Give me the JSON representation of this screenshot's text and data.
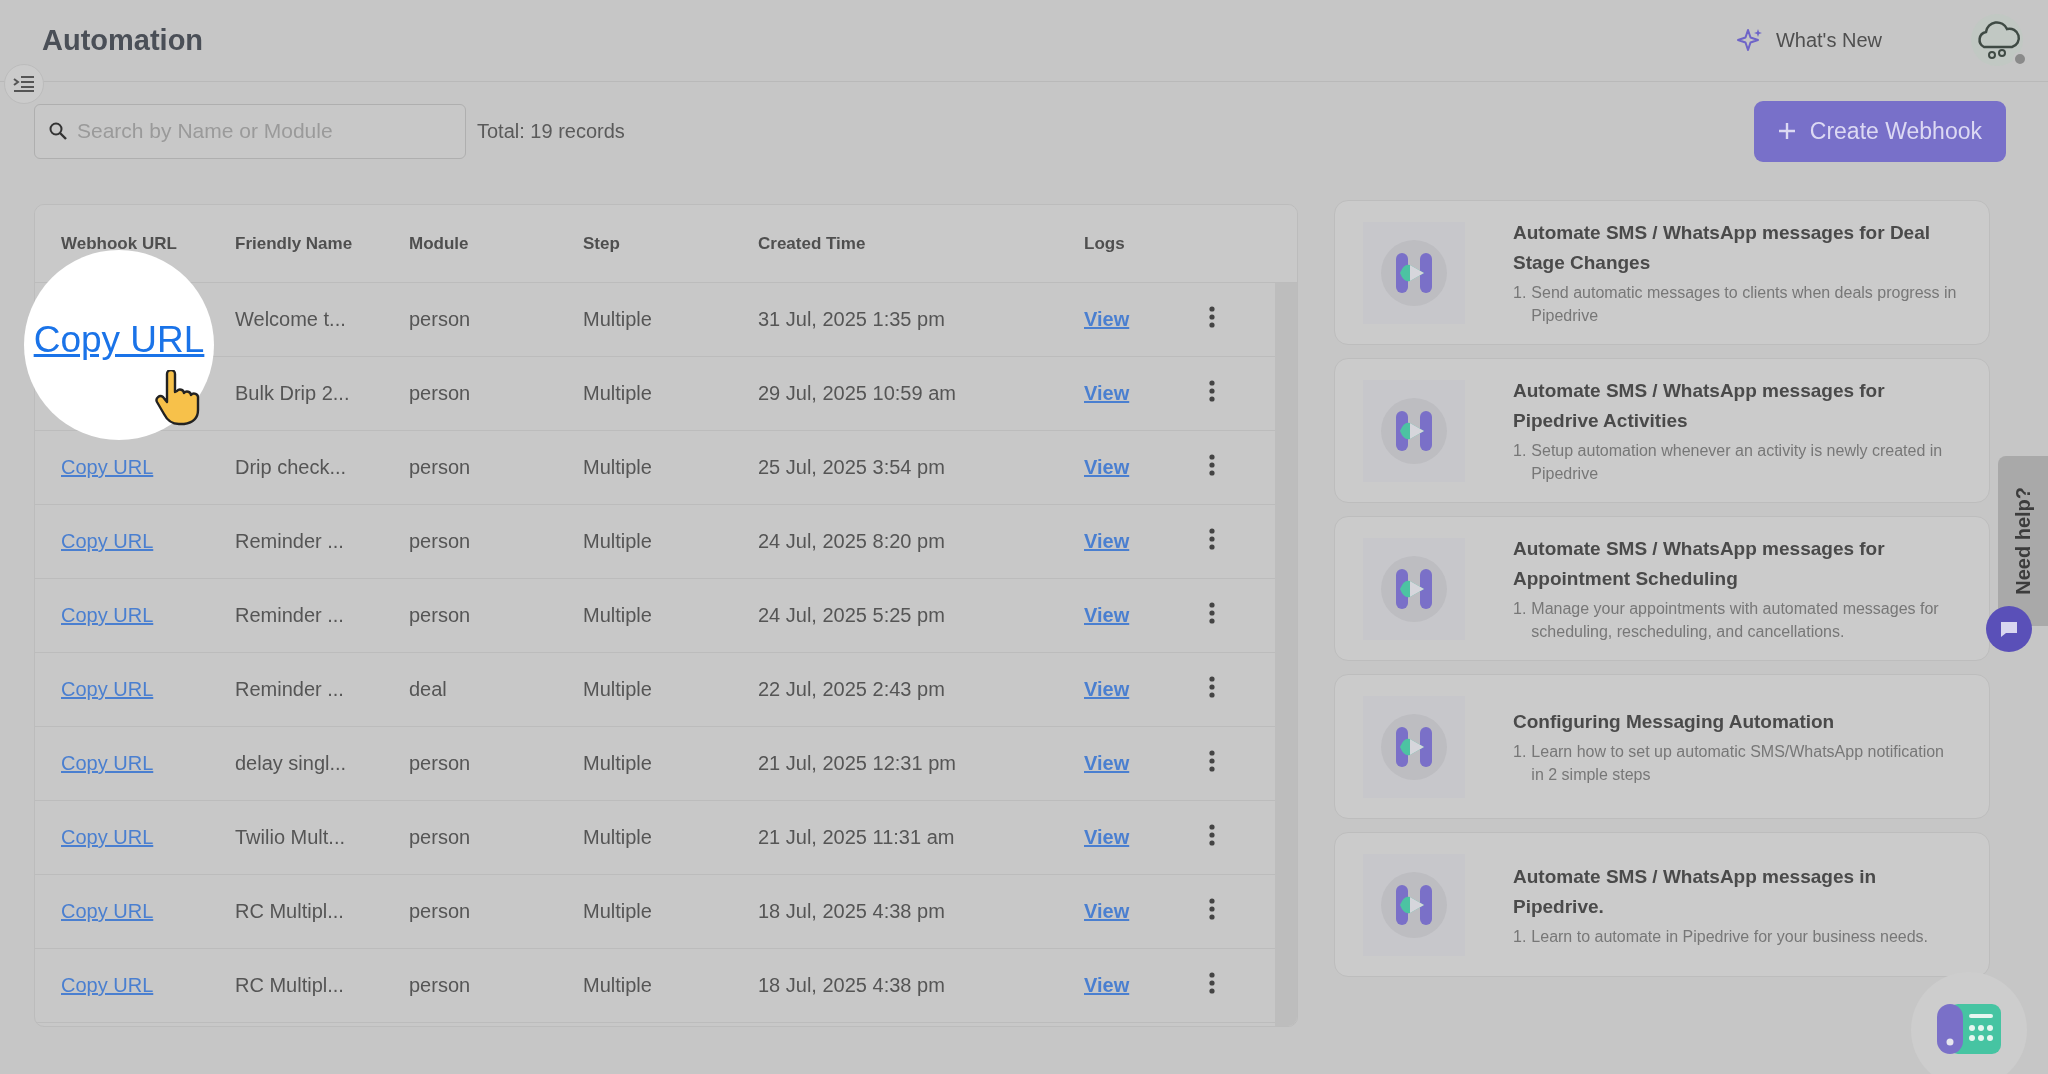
{
  "page": {
    "title": "Automation",
    "whats_new": "What's New"
  },
  "search": {
    "placeholder": "Search by Name or Module"
  },
  "total": "Total: 19 records",
  "create_button": "Create Webhook",
  "table": {
    "columns": [
      "Webhook URL",
      "Friendly Name",
      "Module",
      "Step",
      "Created Time",
      "Logs"
    ],
    "rows": [
      {
        "name": "Welcome t...",
        "module": "person",
        "step": "Multiple",
        "created": "31 Jul, 2025 1:35 pm",
        "logs": "View"
      },
      {
        "name": "Bulk Drip 2...",
        "module": "person",
        "step": "Multiple",
        "created": "29 Jul, 2025 10:59 am",
        "logs": "View"
      },
      {
        "url": "Copy URL",
        "name": "Drip check...",
        "module": "person",
        "step": "Multiple",
        "created": "25 Jul, 2025 3:54 pm",
        "logs": "View"
      },
      {
        "url": "Copy URL",
        "name": "Reminder ...",
        "module": "person",
        "step": "Multiple",
        "created": "24 Jul, 2025 8:20 pm",
        "logs": "View"
      },
      {
        "url": "Copy URL",
        "name": "Reminder ...",
        "module": "person",
        "step": "Multiple",
        "created": "24 Jul, 2025 5:25 pm",
        "logs": "View"
      },
      {
        "url": "Copy URL",
        "name": "Reminder ...",
        "module": "deal",
        "step": "Multiple",
        "created": "22 Jul, 2025 2:43 pm",
        "logs": "View"
      },
      {
        "url": "Copy URL",
        "name": "delay singl...",
        "module": "person",
        "step": "Multiple",
        "created": "21 Jul, 2025 12:31 pm",
        "logs": "View"
      },
      {
        "url": "Copy URL",
        "name": "Twilio Mult...",
        "module": "person",
        "step": "Multiple",
        "created": "21 Jul, 2025 11:31 am",
        "logs": "View"
      },
      {
        "url": "Copy URL",
        "name": "RC Multipl...",
        "module": "person",
        "step": "Multiple",
        "created": "18 Jul, 2025 4:38 pm",
        "logs": "View"
      },
      {
        "url": "Copy URL",
        "name": "RC Multipl...",
        "module": "person",
        "step": "Multiple",
        "created": "18 Jul, 2025 4:38 pm",
        "logs": "View"
      }
    ]
  },
  "spotlight": {
    "text": "Copy URL"
  },
  "guides": [
    {
      "title": "Automate SMS / WhatsApp messages for Deal Stage Changes",
      "steps": [
        {
          "marker": "1.",
          "text": "Send automatic messages to clients when deals progress in Pipedrive"
        }
      ]
    },
    {
      "title": "Automate SMS / WhatsApp messages for Pipedrive Activities",
      "steps": [
        {
          "marker": "1.",
          "text": "Setup automation whenever an activity is newly created in Pipedrive"
        }
      ]
    },
    {
      "title": "Automate SMS / WhatsApp messages for Appointment Scheduling",
      "steps": [
        {
          "marker": "1.",
          "text": "Manage your appointments with automated messages for scheduling, rescheduling, and cancellations."
        }
      ]
    },
    {
      "title": "Configuring Messaging Automation",
      "steps": [
        {
          "marker": "1.",
          "text": "Learn how to set up automatic SMS/WhatsApp notification in 2 simple steps"
        }
      ]
    },
    {
      "title": "Automate SMS / WhatsApp messages in Pipedrive.",
      "steps": [
        {
          "marker": "1.",
          "text": "Learn to automate in Pipedrive for your business needs."
        }
      ]
    }
  ],
  "need_help": "Need help?"
}
